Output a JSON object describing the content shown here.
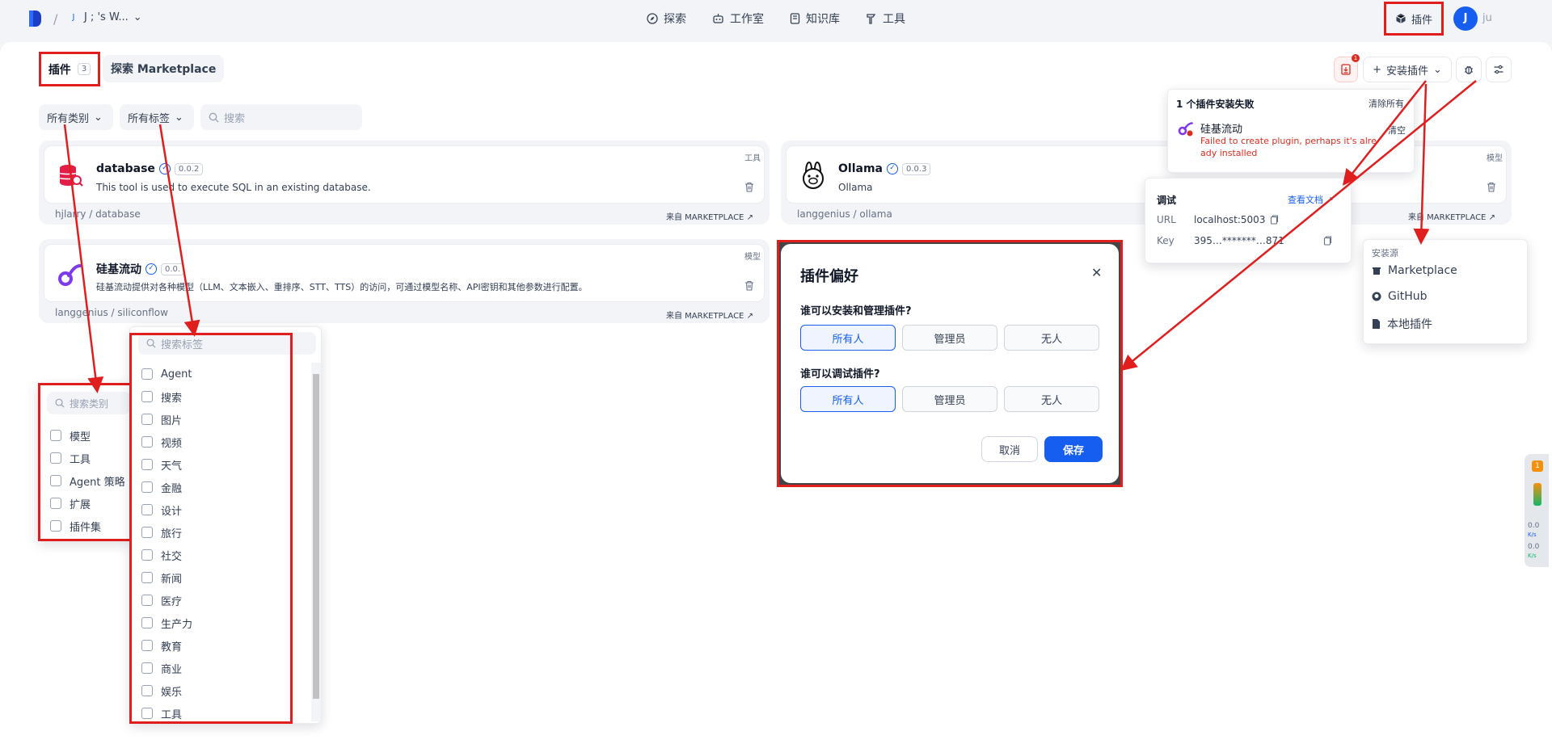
{
  "topbar": {
    "workspace": "J ; 's W...",
    "workspace_initial": "J",
    "nav": [
      {
        "label": "探索",
        "icon": "compass-icon"
      },
      {
        "label": "工作室",
        "icon": "robot-icon"
      },
      {
        "label": "知识库",
        "icon": "book-icon"
      },
      {
        "label": "工具",
        "icon": "hammer-icon"
      }
    ],
    "plugins_label": "插件",
    "avatar_initial": "J",
    "user_name": "ju"
  },
  "tabs": {
    "plugins_label": "插件",
    "plugins_count": "3",
    "marketplace_label": "探索 Marketplace"
  },
  "toolbar": {
    "install_label": "安装插件",
    "notification_count": "1"
  },
  "filters": {
    "category_label": "所有类别",
    "tag_label": "所有标签",
    "search_placeholder": "搜索"
  },
  "cards": [
    {
      "name": "database",
      "version": "0.0.2",
      "tag": "工具",
      "description": "This tool is used to execute SQL in an existing database.",
      "org": "hjlarry",
      "path": "database",
      "from": "来自 MARKETPLACE"
    },
    {
      "name": "Ollama",
      "version": "0.0.3",
      "tag": "模型",
      "description": "Ollama",
      "org": "langgenius",
      "path": "ollama",
      "from": "来自 MARKETPLACE"
    },
    {
      "name": "硅基流动",
      "version": "0.0.",
      "tag": "模型",
      "description": "硅基流动提供对各种模型（LLM、文本嵌入、重排序、STT、TTS）的访问，可通过模型名称、API密钥和其他参数进行配置。",
      "org": "langgenius",
      "path": "siliconflow",
      "from": "来自 MARKETPLACE"
    }
  ],
  "install_error": {
    "title": "1 个插件安装失败",
    "clear_all": "清除所有",
    "plugin_name": "硅基流动",
    "message": "Failed to create plugin, perhaps it's already installed",
    "clear": "清空"
  },
  "debug": {
    "title": "调试",
    "docs_link": "查看文档",
    "url_label": "URL",
    "url_value": "localhost:5003",
    "key_label": "Key",
    "key_value": "395…*******…871"
  },
  "install_source": {
    "title": "安装源",
    "items": [
      {
        "label": "Marketplace",
        "icon": "package-icon"
      },
      {
        "label": "GitHub",
        "icon": "github-icon"
      },
      {
        "label": "本地插件",
        "icon": "file-icon"
      }
    ]
  },
  "preferences": {
    "title": "插件偏好",
    "q1": "谁可以安装和管理插件?",
    "q2": "谁可以调试插件?",
    "options": [
      "所有人",
      "管理员",
      "无人"
    ],
    "q1_selected": "所有人",
    "q2_selected": "所有人",
    "cancel": "取消",
    "save": "保存"
  },
  "category_dropdown": {
    "placeholder": "搜索类别",
    "items": [
      "模型",
      "工具",
      "Agent 策略",
      "扩展",
      "插件集"
    ]
  },
  "tag_dropdown": {
    "placeholder": "搜索标签",
    "items": [
      "Agent",
      "搜索",
      "图片",
      "视频",
      "天气",
      "金融",
      "设计",
      "旅行",
      "社交",
      "新闻",
      "医疗",
      "生产力",
      "教育",
      "商业",
      "娱乐",
      "工具"
    ]
  },
  "net_widget": {
    "badge": "1",
    "up": "0.0",
    "down": "0.0",
    "unit": "K/s"
  },
  "colors": {
    "accent": "#155eef",
    "annotation_red": "#e01e1e",
    "error": "#d92d20"
  }
}
